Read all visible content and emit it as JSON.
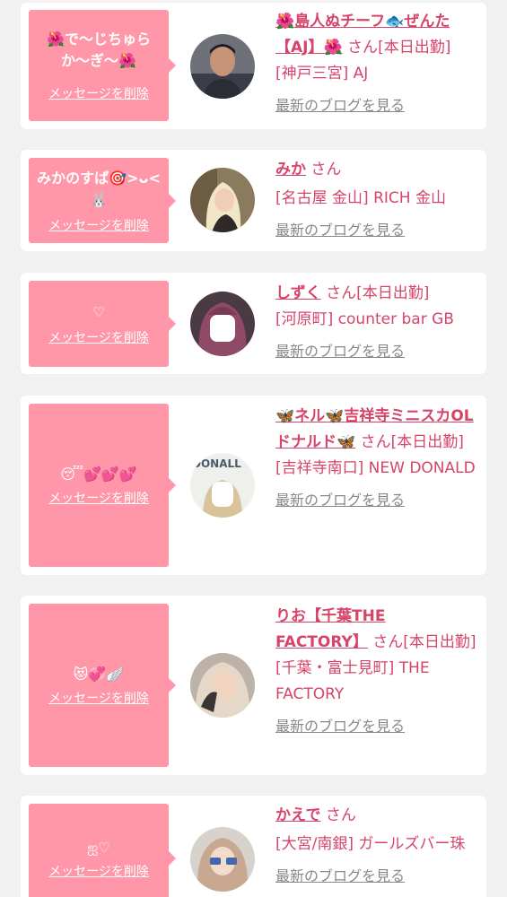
{
  "colors": {
    "accent": "#d6446a",
    "bubble": "#ff97a8",
    "background": "#f1f1f1"
  },
  "delete_label": "メッセージを削除",
  "blog_label": "最新のブログを見る",
  "san_suffix": "さん",
  "items": [
    {
      "message": "🌺で〜じちゅらか〜ぎ〜🌺",
      "name": "🌺島人ぬチーフ🐟ぜんた【AJ】🌺",
      "status": "[本日出勤]",
      "shop": "[神戸三宮] AJ",
      "avatar_icon": "avatar-photo"
    },
    {
      "message": "みかのすぱ🎯>ᴗ<🐰",
      "name": "みか",
      "status": "",
      "shop": "[名古屋 金山] RICH 金山",
      "avatar_icon": "avatar-photo"
    },
    {
      "message": "♡",
      "name": "しずく",
      "status": "[本日出勤]",
      "shop": "[河原町] counter bar GB",
      "avatar_icon": "avatar-photo"
    },
    {
      "message": "😴💕💕💕",
      "name": "🦋ネル🦋吉祥寺ミニスカOLドナルド🦋",
      "status": "[本日出勤]",
      "shop": "[吉祥寺南口] NEW DONALD",
      "avatar_icon": "avatar-photo"
    },
    {
      "message": "😻💞🪽",
      "name": "りお【千葉THE FACTORY】",
      "status": "[本日出勤]",
      "shop": "[千葉・富士見町] THE FACTORY",
      "avatar_icon": "avatar-photo"
    },
    {
      "message": "ஐ♡",
      "name": "かえで",
      "status": "",
      "shop": "[大宮/南銀] ガールズバー珠",
      "avatar_icon": "avatar-photo"
    }
  ]
}
